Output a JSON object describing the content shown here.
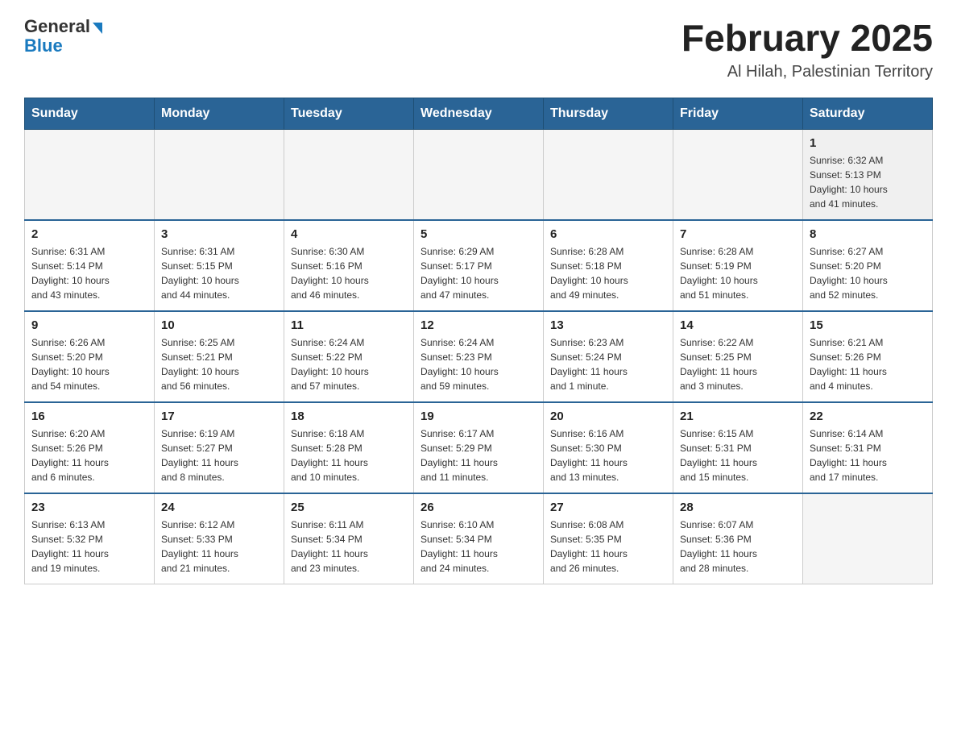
{
  "header": {
    "logo": {
      "general": "General",
      "blue": "Blue"
    },
    "title": "February 2025",
    "subtitle": "Al Hilah, Palestinian Territory"
  },
  "weekdays": [
    "Sunday",
    "Monday",
    "Tuesday",
    "Wednesday",
    "Thursday",
    "Friday",
    "Saturday"
  ],
  "weeks": [
    [
      {
        "day": "",
        "info": ""
      },
      {
        "day": "",
        "info": ""
      },
      {
        "day": "",
        "info": ""
      },
      {
        "day": "",
        "info": ""
      },
      {
        "day": "",
        "info": ""
      },
      {
        "day": "",
        "info": ""
      },
      {
        "day": "1",
        "info": "Sunrise: 6:32 AM\nSunset: 5:13 PM\nDaylight: 10 hours\nand 41 minutes."
      }
    ],
    [
      {
        "day": "2",
        "info": "Sunrise: 6:31 AM\nSunset: 5:14 PM\nDaylight: 10 hours\nand 43 minutes."
      },
      {
        "day": "3",
        "info": "Sunrise: 6:31 AM\nSunset: 5:15 PM\nDaylight: 10 hours\nand 44 minutes."
      },
      {
        "day": "4",
        "info": "Sunrise: 6:30 AM\nSunset: 5:16 PM\nDaylight: 10 hours\nand 46 minutes."
      },
      {
        "day": "5",
        "info": "Sunrise: 6:29 AM\nSunset: 5:17 PM\nDaylight: 10 hours\nand 47 minutes."
      },
      {
        "day": "6",
        "info": "Sunrise: 6:28 AM\nSunset: 5:18 PM\nDaylight: 10 hours\nand 49 minutes."
      },
      {
        "day": "7",
        "info": "Sunrise: 6:28 AM\nSunset: 5:19 PM\nDaylight: 10 hours\nand 51 minutes."
      },
      {
        "day": "8",
        "info": "Sunrise: 6:27 AM\nSunset: 5:20 PM\nDaylight: 10 hours\nand 52 minutes."
      }
    ],
    [
      {
        "day": "9",
        "info": "Sunrise: 6:26 AM\nSunset: 5:20 PM\nDaylight: 10 hours\nand 54 minutes."
      },
      {
        "day": "10",
        "info": "Sunrise: 6:25 AM\nSunset: 5:21 PM\nDaylight: 10 hours\nand 56 minutes."
      },
      {
        "day": "11",
        "info": "Sunrise: 6:24 AM\nSunset: 5:22 PM\nDaylight: 10 hours\nand 57 minutes."
      },
      {
        "day": "12",
        "info": "Sunrise: 6:24 AM\nSunset: 5:23 PM\nDaylight: 10 hours\nand 59 minutes."
      },
      {
        "day": "13",
        "info": "Sunrise: 6:23 AM\nSunset: 5:24 PM\nDaylight: 11 hours\nand 1 minute."
      },
      {
        "day": "14",
        "info": "Sunrise: 6:22 AM\nSunset: 5:25 PM\nDaylight: 11 hours\nand 3 minutes."
      },
      {
        "day": "15",
        "info": "Sunrise: 6:21 AM\nSunset: 5:26 PM\nDaylight: 11 hours\nand 4 minutes."
      }
    ],
    [
      {
        "day": "16",
        "info": "Sunrise: 6:20 AM\nSunset: 5:26 PM\nDaylight: 11 hours\nand 6 minutes."
      },
      {
        "day": "17",
        "info": "Sunrise: 6:19 AM\nSunset: 5:27 PM\nDaylight: 11 hours\nand 8 minutes."
      },
      {
        "day": "18",
        "info": "Sunrise: 6:18 AM\nSunset: 5:28 PM\nDaylight: 11 hours\nand 10 minutes."
      },
      {
        "day": "19",
        "info": "Sunrise: 6:17 AM\nSunset: 5:29 PM\nDaylight: 11 hours\nand 11 minutes."
      },
      {
        "day": "20",
        "info": "Sunrise: 6:16 AM\nSunset: 5:30 PM\nDaylight: 11 hours\nand 13 minutes."
      },
      {
        "day": "21",
        "info": "Sunrise: 6:15 AM\nSunset: 5:31 PM\nDaylight: 11 hours\nand 15 minutes."
      },
      {
        "day": "22",
        "info": "Sunrise: 6:14 AM\nSunset: 5:31 PM\nDaylight: 11 hours\nand 17 minutes."
      }
    ],
    [
      {
        "day": "23",
        "info": "Sunrise: 6:13 AM\nSunset: 5:32 PM\nDaylight: 11 hours\nand 19 minutes."
      },
      {
        "day": "24",
        "info": "Sunrise: 6:12 AM\nSunset: 5:33 PM\nDaylight: 11 hours\nand 21 minutes."
      },
      {
        "day": "25",
        "info": "Sunrise: 6:11 AM\nSunset: 5:34 PM\nDaylight: 11 hours\nand 23 minutes."
      },
      {
        "day": "26",
        "info": "Sunrise: 6:10 AM\nSunset: 5:34 PM\nDaylight: 11 hours\nand 24 minutes."
      },
      {
        "day": "27",
        "info": "Sunrise: 6:08 AM\nSunset: 5:35 PM\nDaylight: 11 hours\nand 26 minutes."
      },
      {
        "day": "28",
        "info": "Sunrise: 6:07 AM\nSunset: 5:36 PM\nDaylight: 11 hours\nand 28 minutes."
      },
      {
        "day": "",
        "info": ""
      }
    ]
  ]
}
